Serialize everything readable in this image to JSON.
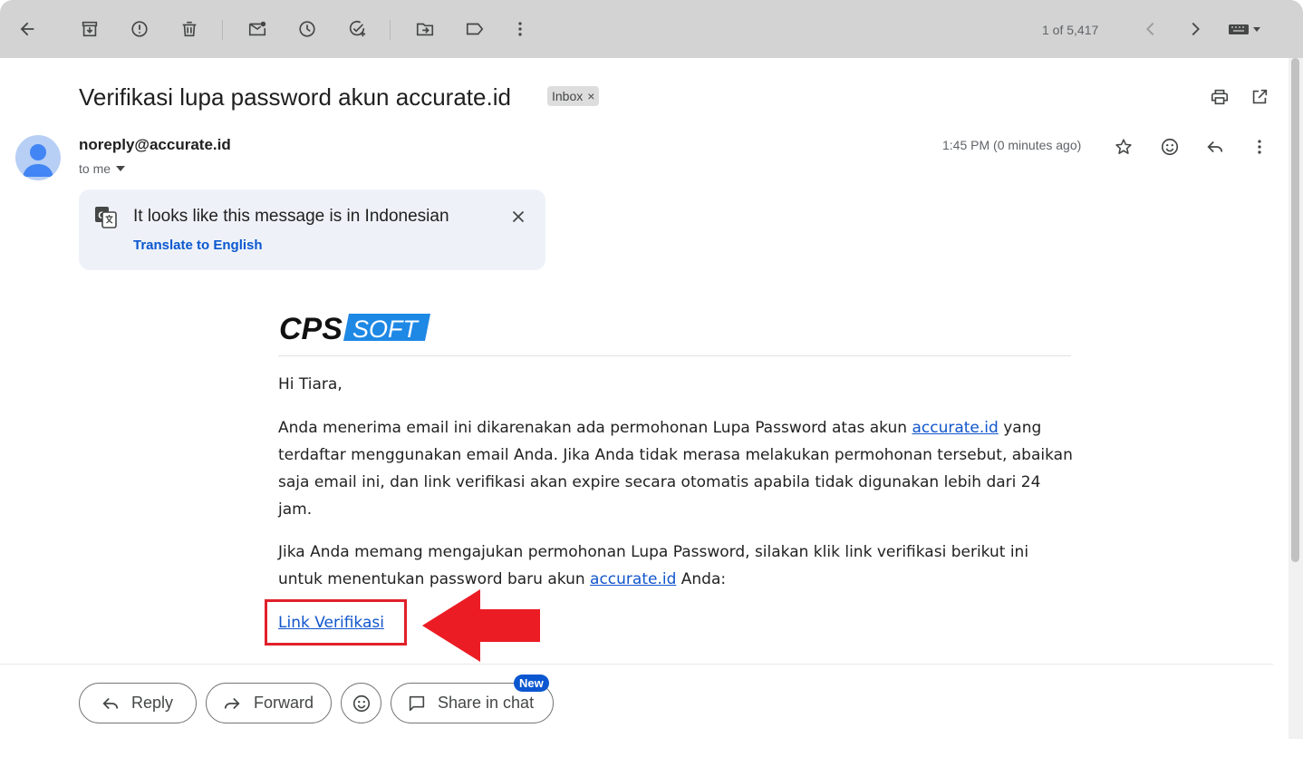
{
  "toolbar": {
    "back_icon": "arrow-back-icon",
    "pager": "1 of 5,417"
  },
  "message": {
    "subject": "Verifikasi lupa password akun accurate.id",
    "label_chip": "Inbox",
    "chip_close": "×",
    "sender": "noreply@accurate.id",
    "recipient": "to me",
    "time": "1:45 PM (0 minutes ago)"
  },
  "translate": {
    "title": "It looks like this message is in Indonesian",
    "action": "Translate to English"
  },
  "email_body": {
    "logo_left": "CPS",
    "logo_right": "SOFT",
    "greeting": "Hi Tiara,",
    "para1_before": "Anda menerima email ini dikarenakan ada permohonan Lupa Password atas akun ",
    "link_text": "accurate.id",
    "para1_after": " yang terdaftar menggunakan email Anda. Jika Anda tidak merasa melakukan permohonan tersebut, abaikan saja email ini, dan link verifikasi akan expire secara otomatis apabila tidak digunakan lebih dari 24 jam.",
    "para2_before": "Jika Anda memang mengajukan permohonan Lupa Password, silakan klik link verifikasi berikut ini untuk menentukan password baru akun ",
    "para2_after": " Anda:",
    "verify_link": "Link Verifikasi"
  },
  "actions": {
    "reply": "Reply",
    "forward": "Forward",
    "share": "Share in chat",
    "new_badge": "New"
  },
  "colors": {
    "link": "#1155cc",
    "accent_blue": "#0b57d0",
    "annotation_red": "#e0202a",
    "logo_blue": "#1e88e5"
  }
}
